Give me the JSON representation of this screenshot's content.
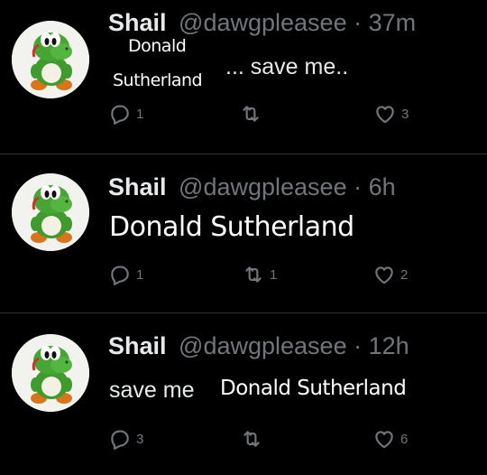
{
  "tweets": [
    {
      "name": "Shail",
      "handle": "@dawgpleasee",
      "separator": "·",
      "time": "37m",
      "overlay_line1": "Donald",
      "overlay_line2": "Sutherland",
      "text": "... save me..",
      "actions": {
        "replies": "1",
        "retweets": "",
        "likes": "3"
      }
    },
    {
      "name": "Shail",
      "handle": "@dawgpleasee",
      "separator": "·",
      "time": "6h",
      "overlay": "Donald Sutherland",
      "actions": {
        "replies": "1",
        "retweets": "1",
        "likes": "2"
      }
    },
    {
      "name": "Shail",
      "handle": "@dawgpleasee",
      "separator": "·",
      "time": "12h",
      "text": "save me",
      "overlay": "Donald Sutherland",
      "actions": {
        "replies": "3",
        "retweets": "",
        "likes": "6"
      }
    }
  ],
  "icons": {
    "reply": "reply-icon",
    "retweet": "retweet-icon",
    "like": "heart-icon",
    "avatar": "yoshi-avatar"
  },
  "colors": {
    "background": "#000000",
    "secondary_text": "#71767b",
    "primary_text": "#e7e9ea",
    "divider": "#2f3336"
  }
}
